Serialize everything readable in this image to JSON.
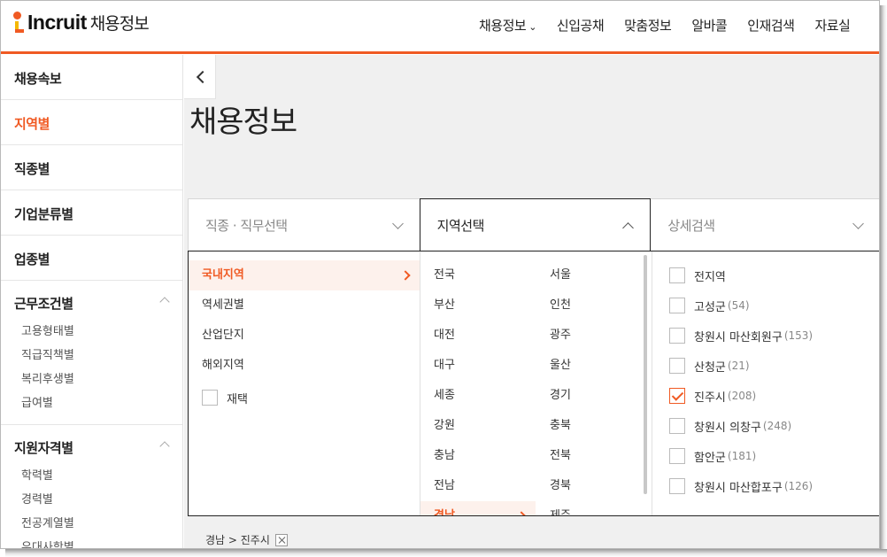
{
  "header": {
    "logo_text": "Incruit",
    "logo_sub": "채용정보",
    "nav": [
      {
        "label": "채용정보",
        "dropdown": true
      },
      {
        "label": "신입공채"
      },
      {
        "label": "맞춤정보"
      },
      {
        "label": "알바콜"
      },
      {
        "label": "인재검색"
      },
      {
        "label": "자료실"
      }
    ]
  },
  "sidebar": {
    "items": [
      {
        "label": "채용속보"
      },
      {
        "label": "지역별",
        "active": true
      },
      {
        "label": "직종별"
      },
      {
        "label": "기업분류별"
      },
      {
        "label": "업종별"
      }
    ],
    "groups": [
      {
        "label": "근무조건별",
        "subs": [
          "고용형태별",
          "직급직책별",
          "복리후생별",
          "급여별"
        ]
      },
      {
        "label": "지원자격별",
        "subs": [
          "학력별",
          "경력별",
          "전공계열별",
          "우대사항별"
        ]
      }
    ]
  },
  "main": {
    "title": "채용정보",
    "selectors": {
      "job": "직종 · 직무선택",
      "region": "지역선택",
      "detail": "상세검색"
    },
    "region_types": [
      "국내지역",
      "역세권별",
      "산업단지",
      "해외지역"
    ],
    "region_type_active": "국내지역",
    "remote_label": "재택",
    "regions": [
      "전국",
      "서울",
      "부산",
      "인천",
      "대전",
      "광주",
      "대구",
      "울산",
      "세종",
      "경기",
      "강원",
      "충북",
      "충남",
      "전북",
      "전남",
      "경북",
      "경남",
      "제주"
    ],
    "region_active": "경남",
    "districts": [
      {
        "name": "전지역",
        "count": "",
        "checked": false
      },
      {
        "name": "고성군",
        "count": "(54)",
        "checked": false
      },
      {
        "name": "창원시 마산회원구",
        "count": "(153)",
        "checked": false
      },
      {
        "name": "산청군",
        "count": "(21)",
        "checked": false
      },
      {
        "name": "진주시",
        "count": "(208)",
        "checked": true
      },
      {
        "name": "창원시 의창구",
        "count": "(248)",
        "checked": false
      },
      {
        "name": "함안군",
        "count": "(181)",
        "checked": false
      },
      {
        "name": "창원시 마산합포구",
        "count": "(126)",
        "checked": false
      }
    ],
    "selected_crumb": "경남 > 진주시"
  },
  "colors": {
    "accent": "#f05a23",
    "accent_bg": "#fdf1ec"
  }
}
